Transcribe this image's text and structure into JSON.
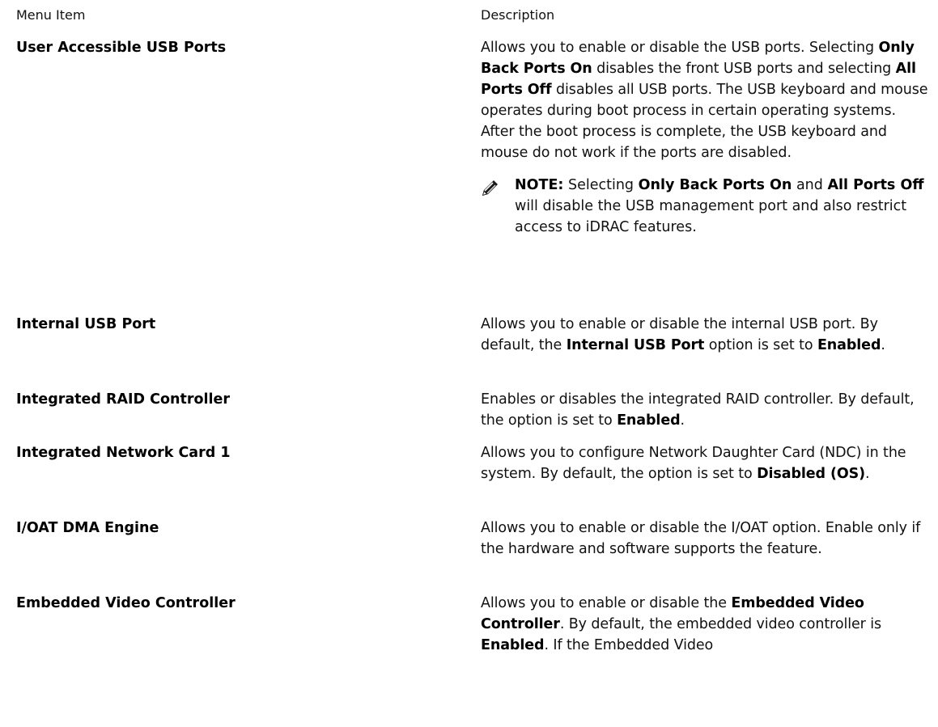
{
  "table": {
    "header": {
      "col1": "Menu Item",
      "col2": "Description"
    },
    "rows": [
      {
        "name": "User Accessible USB Ports",
        "desc": {
          "p1": "Allows you to enable or disable the USB ports.",
          "p2": "Selecting ",
          "b1": "Only Back Ports On",
          "p3": " disables the front USB ports and selecting ",
          "b2": "All Ports Off",
          "p4": " disables all USB ports. The USB keyboard and mouse operates during boot process in certain operating systems. After the boot process is complete, the USB keyboard and mouse do not work if the ports are disabled."
        },
        "note": {
          "label": "NOTE:",
          "t1": " Selecting ",
          "b1": "Only Back Ports On",
          "t2": " and ",
          "b2": "All Ports Off",
          "t3": " will disable the USB management port and also restrict access to iDRAC features."
        }
      },
      {
        "name": "Internal USB Port",
        "desc": {
          "t1": "Allows you to enable or disable the internal USB port. By default, the ",
          "b1": "Internal USB Port",
          "t2": " option is set to ",
          "b2": "Enabled",
          "t3": "."
        }
      },
      {
        "name": "Integrated RAID Controller",
        "desc": {
          "t1": "Enables or disables the integrated RAID controller. By default, the option is set to ",
          "b1": "Enabled",
          "t2": "."
        }
      },
      {
        "name": "Integrated Network Card 1",
        "desc": {
          "t1": "Allows you to configure Network Daughter Card (NDC) in the system. By default, the option is set to ",
          "b1": "Disabled (OS)",
          "t2": "."
        }
      },
      {
        "name": "I/OAT DMA Engine",
        "desc": {
          "t1": "Allows you to enable or disable the I/OAT option. Enable only if the hardware and software supports the feature."
        }
      },
      {
        "name": "Embedded Video Controller",
        "desc": {
          "t1": "Allows you to enable or disable the ",
          "b1": "Embedded Video Controller",
          "t2": ". By default, the embedded video controller is ",
          "b2": "Enabled",
          "t3": ". If the Embedded Video"
        }
      }
    ]
  },
  "icons": {
    "note": "pencil-note-icon"
  }
}
